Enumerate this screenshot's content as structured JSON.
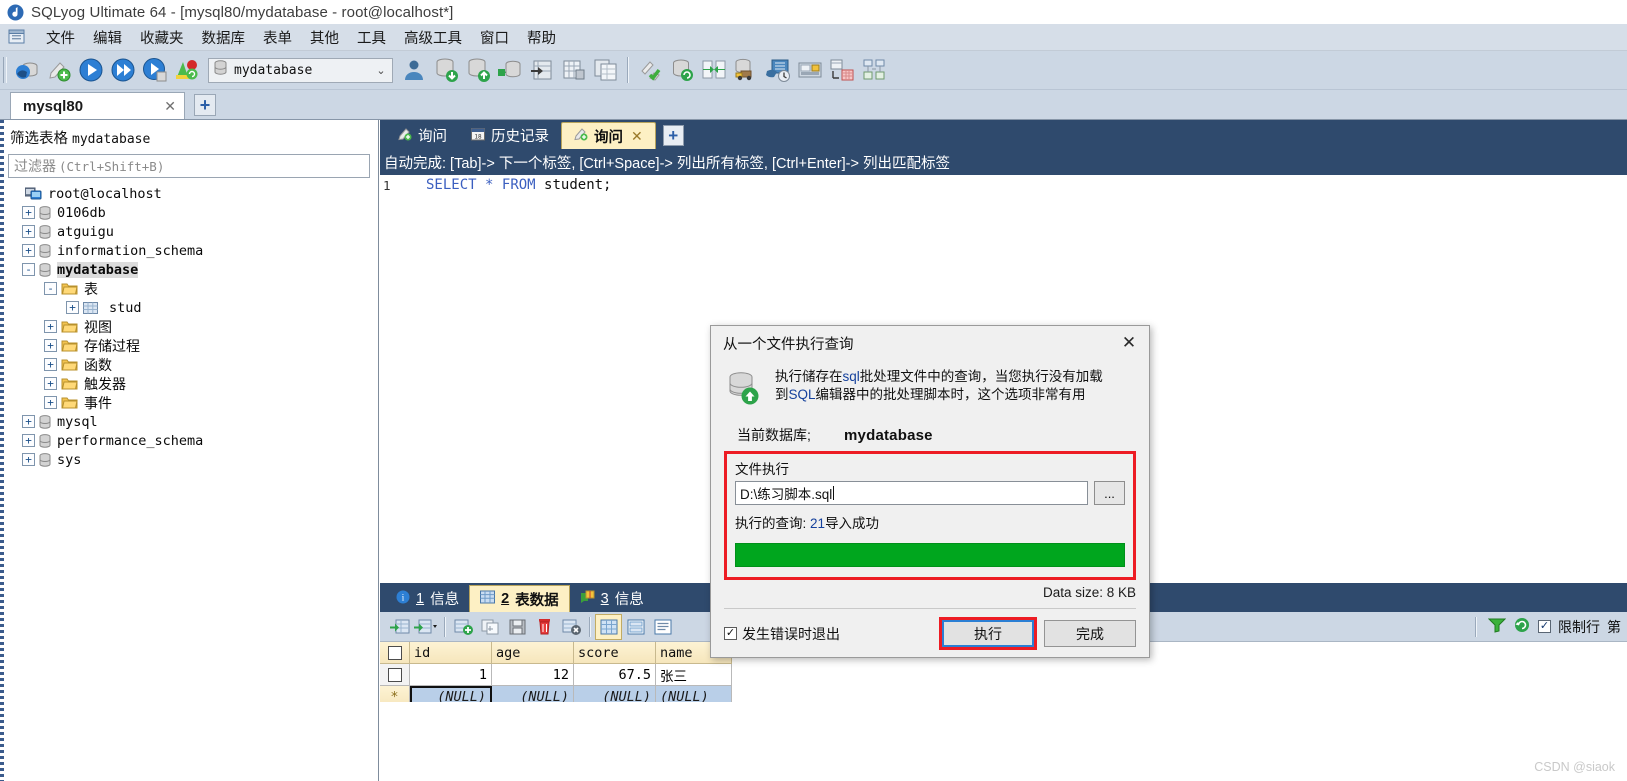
{
  "window": {
    "title": "SQLyog Ultimate 64 - [mysql80/mydatabase - root@localhost*]",
    "logo_icon": "sqlyog-logo-icon"
  },
  "menubar": {
    "app_icon": "window-menu-icon",
    "items": [
      {
        "label": "文件"
      },
      {
        "label": "编辑"
      },
      {
        "label": "收藏夹"
      },
      {
        "label": "数据库"
      },
      {
        "label": "表单"
      },
      {
        "label": "其他"
      },
      {
        "label": "工具"
      },
      {
        "label": "高级工具"
      },
      {
        "label": "窗口"
      },
      {
        "label": "帮助"
      }
    ]
  },
  "toolbar": {
    "database_combo": {
      "value": "mydatabase",
      "icon": "database-icon",
      "chevron": "▼"
    },
    "buttons": [
      {
        "name": "new-connection-icon"
      },
      {
        "name": "new-query-icon"
      },
      {
        "name": "execute-query-icon"
      },
      {
        "name": "execute-all-queries-icon"
      },
      {
        "name": "execute-query-stop-icon"
      },
      {
        "name": "refresh-object-browser-icon"
      }
    ],
    "buttons_right": [
      {
        "name": "user-manager-icon"
      },
      {
        "name": "backup-database-icon"
      },
      {
        "name": "restore-database-icon"
      },
      {
        "name": "import-external-data-icon"
      },
      {
        "name": "export-grid-icon"
      },
      {
        "name": "table-diagnostics-icon"
      },
      {
        "name": "copy-database-icon"
      },
      {
        "name": "flush-icon"
      },
      {
        "name": "sync-database-icon"
      },
      {
        "name": "schema-sync-icon"
      },
      {
        "name": "migration-icon"
      },
      {
        "name": "scheduled-backup-icon"
      },
      {
        "name": "query-builder-icon"
      },
      {
        "name": "schema-designer-icon"
      },
      {
        "name": "form-view-icon"
      }
    ]
  },
  "connection_tabs": {
    "tabs": [
      {
        "label": "mysql80",
        "close": "✕",
        "active": true
      }
    ],
    "add_label": "+"
  },
  "object_browser": {
    "title_prefix": "筛选表格",
    "title_db": "mydatabase",
    "filter_placeholder_cjk": "过滤器",
    "filter_placeholder_key": "(Ctrl+Shift+B)",
    "tree": [
      {
        "label": "root@localhost",
        "icon": "host-icon",
        "indent": 0,
        "toggle": "",
        "bold": false
      },
      {
        "label": "0106db",
        "icon": "database-icon",
        "indent": 1,
        "toggle": "+",
        "bold": false
      },
      {
        "label": "atguigu",
        "icon": "database-icon",
        "indent": 1,
        "toggle": "+",
        "bold": false
      },
      {
        "label": "information_schema",
        "icon": "database-icon",
        "indent": 1,
        "toggle": "+",
        "bold": false
      },
      {
        "label": "mydatabase",
        "icon": "database-icon",
        "indent": 1,
        "toggle": "-",
        "bold": true,
        "selected": true
      },
      {
        "label": "表",
        "icon": "folder-icon",
        "indent": 2,
        "toggle": "-",
        "cjk": true
      },
      {
        "label": "stud",
        "icon": "table-icon",
        "indent": 3,
        "toggle": "+"
      },
      {
        "label": "视图",
        "icon": "folder-icon",
        "indent": 2,
        "toggle": "+",
        "cjk": true
      },
      {
        "label": "存储过程",
        "icon": "folder-icon",
        "indent": 2,
        "toggle": "+",
        "cjk": true
      },
      {
        "label": "函数",
        "icon": "folder-icon",
        "indent": 2,
        "toggle": "+",
        "cjk": true
      },
      {
        "label": "触发器",
        "icon": "folder-icon",
        "indent": 2,
        "toggle": "+",
        "cjk": true
      },
      {
        "label": "事件",
        "icon": "folder-icon",
        "indent": 2,
        "toggle": "+",
        "cjk": true
      },
      {
        "label": "mysql",
        "icon": "database-icon",
        "indent": 1,
        "toggle": "+"
      },
      {
        "label": "performance_schema",
        "icon": "database-icon",
        "indent": 1,
        "toggle": "+"
      },
      {
        "label": "sys",
        "icon": "database-icon",
        "indent": 1,
        "toggle": "+"
      }
    ]
  },
  "query_area": {
    "tabs": [
      {
        "label": "询问",
        "icon": "query-icon",
        "active": false,
        "closable": false
      },
      {
        "label": "历史记录",
        "icon": "history-icon",
        "active": false,
        "closable": false
      },
      {
        "label": "询问",
        "icon": "query-icon",
        "active": true,
        "closable": true,
        "close": "✕"
      }
    ],
    "add_label": "+",
    "autocomplete_hint": "自动完成: [Tab]-> 下一个标签, [Ctrl+Space]-> 列出所有标签, [Ctrl+Enter]-> 列出匹配标签",
    "line_number": "1",
    "sql": {
      "kw_select": "SELECT",
      "star": "*",
      "kw_from": "FROM",
      "table": "student;"
    }
  },
  "result_area": {
    "tabs": [
      {
        "num": "1",
        "label": "信息",
        "icon": "info-icon",
        "active": false
      },
      {
        "num": "2",
        "label": "表数据",
        "icon": "table-data-icon",
        "active": true
      },
      {
        "num": "3",
        "label": "信息",
        "icon": "messages-icon",
        "active": false
      }
    ],
    "grid_toolbar_buttons": [
      {
        "name": "refresh-data-icon"
      },
      {
        "name": "export-data-dropdown-icon"
      },
      {
        "name": "insert-row-icon"
      },
      {
        "name": "duplicate-row-icon"
      },
      {
        "name": "save-changes-icon"
      },
      {
        "name": "delete-row-icon"
      },
      {
        "name": "cancel-changes-icon"
      },
      {
        "name": "grid-view-icon"
      },
      {
        "name": "form-view-icon"
      },
      {
        "name": "text-view-icon"
      }
    ],
    "right_controls": {
      "filter_icon": "filter-funnel-icon",
      "refresh_icon": "refresh-circle-icon",
      "limit_checkbox_label": "限制行",
      "limit_checkbox_checked": true,
      "rows_label": "第"
    },
    "grid": {
      "columns": [
        "id",
        "age",
        "score",
        "name"
      ],
      "rows": [
        {
          "id": "1",
          "age": "12",
          "score": "67.5",
          "name": "张三"
        }
      ],
      "new_row": {
        "marker": "*",
        "id": "(NULL)",
        "age": "(NULL)",
        "score": "(NULL)",
        "name": "(NULL)"
      }
    }
  },
  "dialog": {
    "title": "从一个文件执行查询",
    "close_glyph": "✕",
    "icon": "execute-sql-file-icon",
    "description_line1_a": "执行储存在",
    "description_line1_b": "sql",
    "description_line1_c": "批处理文件中的查询，当您执行没有加载",
    "description_line2_a": "到",
    "description_line2_b": "SQL",
    "description_line2_c": "编辑器中的批处理脚本时，这个选项非常有用",
    "current_db_label": "当前数据库;",
    "current_db_value": "mydatabase",
    "file_group_label": "文件执行",
    "file_path": "D:\\练习脚本.sql",
    "browse_label": "...",
    "exec_status_label": "执行的查询:",
    "exec_status_count": "21",
    "exec_status_suffix": "导入成功",
    "progress_percent": 100,
    "progress_color": "#00a61e",
    "data_size_label": "Data size: 8 KB",
    "abort_checkbox_label": "发生错误时退出",
    "abort_checkbox_checked": true,
    "execute_button": "执行",
    "done_button": "完成",
    "highlight_color": "#ed1c24",
    "focus_color": "#2b7fd4"
  },
  "watermark": "CSDN @siaok"
}
